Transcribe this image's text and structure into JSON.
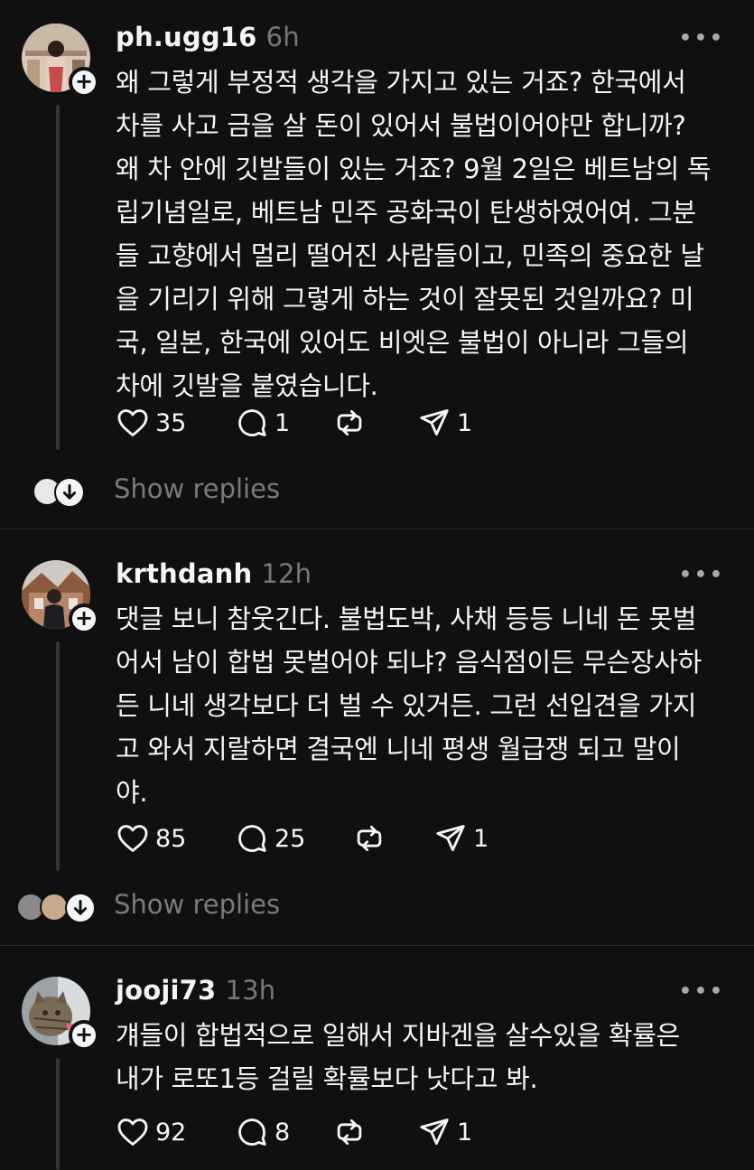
{
  "posts": [
    {
      "username": "ph.ugg16",
      "time": "6h",
      "text": "왜 그렇게 부정적 생각을 가지고 있는 거죠? 한국에서\n차를 사고 금을 살 돈이 있어서 불법이어야만 합니까?\n왜 차 안에 깃발들이 있는 거죠? 9월 2일은 베트남의 독\n립기념일로, 베트남 민주 공화국이 탄생하였어여. 그분\n들 고향에서 멀리 떨어진 사람들이고, 민족의 중요한 날\n을 기리기 위해 그렇게 하는 것이 잘못된 것일까요? 미\n국, 일본, 한국에 있어도 비엣은 불법이 아니라 그들의\n차에 깃발을 붙였습니다.",
      "likes": "35",
      "replies": "1",
      "reposts": "",
      "shares": "1",
      "show_replies": "Show replies"
    },
    {
      "username": "krthdanh",
      "time": "12h",
      "text": "댓글 보니 참웃긴다. 불법도박, 사채 등등 니네 돈 못벌\n어서 남이 합법 못벌어야 되냐? 음식점이든 무슨장사하\n든 니네 생각보다 더 벌 수 있거든. 그런 선입견을 가지\n고 와서 지랄하면 결국엔 니네 평생 월급쟁 되고 말이\n야.",
      "likes": "85",
      "replies": "25",
      "reposts": "",
      "shares": "1",
      "show_replies": "Show replies"
    },
    {
      "username": "jooji73",
      "time": "13h",
      "text": "걔들이 합법적으로 일해서 지바겐을 살수있을 확률은\n내가 로또1등 걸릴 확률보다 낫다고 봐.",
      "likes": "92",
      "replies": "8",
      "reposts": "",
      "shares": "1"
    }
  ],
  "icons": {
    "more": "more-horizontal-icon",
    "like": "heart-icon",
    "reply": "comment-icon",
    "repost": "repost-icon",
    "share": "send-icon",
    "follow": "plus-icon",
    "expand": "arrow-down-icon"
  },
  "colors": {
    "background": "#101010",
    "text": "#f3f5f7",
    "muted": "#777777"
  }
}
